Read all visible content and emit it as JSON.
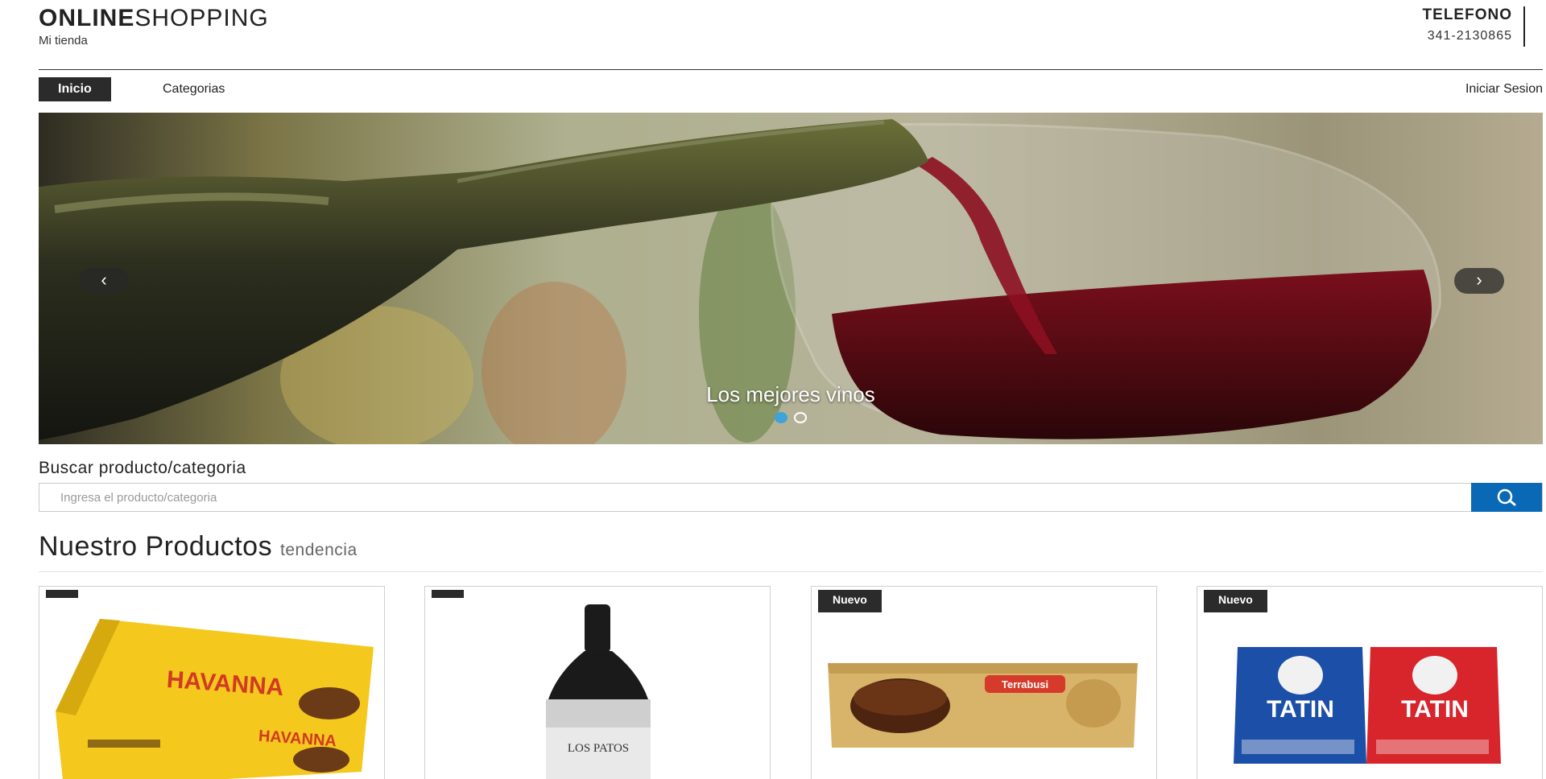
{
  "header": {
    "brand_bold": "ONLINE",
    "brand_light": "SHOPPING",
    "subtitle": "Mi tienda",
    "contact_label": "TELEFONO",
    "contact_phone": "341-2130865"
  },
  "nav": {
    "items": [
      {
        "label": "Inicio",
        "active": true
      },
      {
        "label": "Categorias",
        "active": false
      }
    ],
    "login_label": "Iniciar Sesion"
  },
  "carousel": {
    "caption": "Los mejores vinos",
    "prev_label": "‹",
    "next_label": "›",
    "slide_count": 2,
    "active_slide": 1
  },
  "search": {
    "label": "Buscar producto/categoria",
    "placeholder": "Ingresa el producto/categoria",
    "button_icon": "search-icon"
  },
  "products": {
    "title": "Nuestro Productos",
    "subtitle": "tendencia",
    "items": [
      {
        "badge": "",
        "brand_text": "HAVANNA",
        "image": "havanna-alfajores-box"
      },
      {
        "badge": "",
        "brand_text": "LOS PATOS",
        "image": "wine-bottle"
      },
      {
        "badge": "Nuevo",
        "brand_text": "Terrabusi",
        "image": "alfajor-clasico"
      },
      {
        "badge": "Nuevo",
        "brand_text": "TATIN",
        "image": "tatin-alfajores"
      }
    ]
  },
  "colors": {
    "dark": "#2b2b2b",
    "search_button": "#0a69b7",
    "dot_active": "#3fa3d9"
  }
}
